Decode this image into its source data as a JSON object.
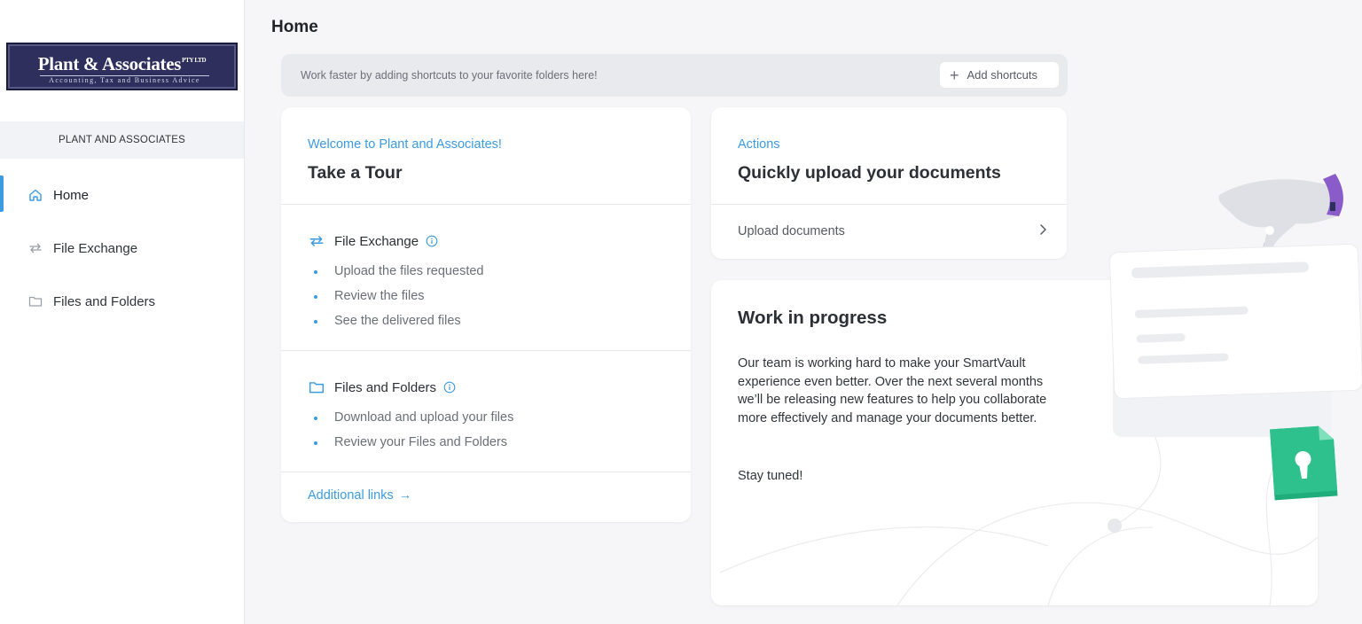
{
  "logo": {
    "name": "Plant & Associates",
    "superscript": "PTY LTD",
    "tagline": "Accounting, Tax and Business Advice"
  },
  "sidebar": {
    "org_name": "PLANT AND ASSOCIATES",
    "items": [
      {
        "label": "Home",
        "icon": "home-icon",
        "active": true
      },
      {
        "label": "File Exchange",
        "icon": "exchange-icon",
        "active": false
      },
      {
        "label": "Files and Folders",
        "icon": "folder-icon",
        "active": false
      }
    ]
  },
  "header": {
    "title": "Home"
  },
  "shortcuts": {
    "message": "Work faster by adding shortcuts to your favorite folders here!",
    "button_label": "Add shortcuts"
  },
  "tour": {
    "eyebrow": "Welcome to Plant and Associates!",
    "title": "Take a Tour",
    "sections": [
      {
        "title": "File Exchange",
        "icon": "exchange-icon",
        "items": [
          "Upload the files requested",
          "Review the files",
          "See the delivered files"
        ]
      },
      {
        "title": "Files and Folders",
        "icon": "folder-icon",
        "items": [
          "Download and upload your files",
          "Review your Files and Folders"
        ]
      }
    ],
    "additional_links": "Additional links",
    "additional_links_arrow": "→"
  },
  "actions": {
    "eyebrow": "Actions",
    "title": "Quickly upload your documents",
    "upload_label": "Upload documents"
  },
  "wip": {
    "title": "Work in progress",
    "body": "Our team is working hard to make your SmartVault experience even better. Over the next several months we’ll be releasing new features to help you collaborate more effectively and manage your documents better.",
    "footer": "Stay tuned!"
  },
  "colors": {
    "accent": "#3b9be0",
    "logo_bg": "#2f2f5e",
    "illustration_green": "#2ec08d",
    "illustration_purple": "#8a5cc9"
  }
}
